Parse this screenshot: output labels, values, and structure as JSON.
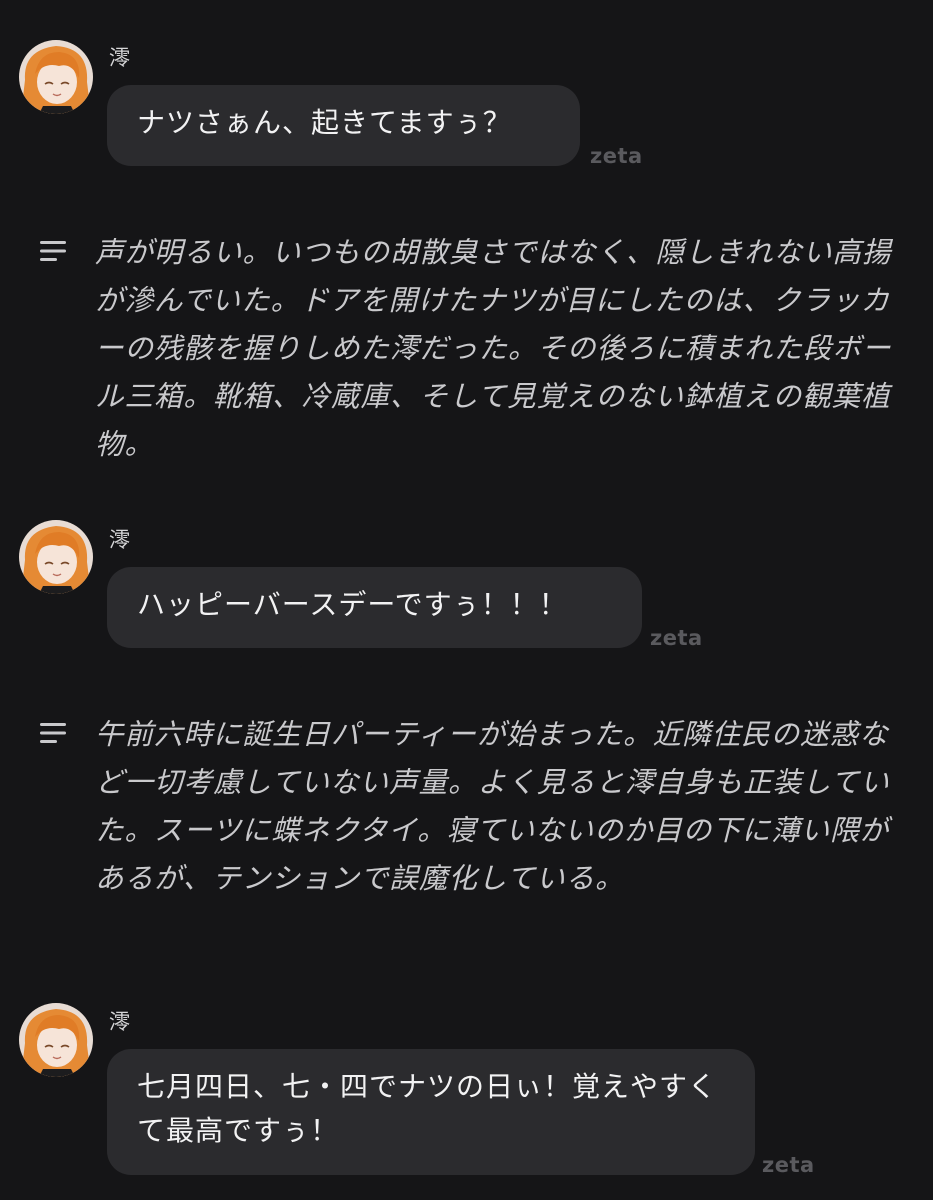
{
  "messages": [
    {
      "sender": "澪",
      "text": "ナツさぁん、起きてますぅ？",
      "brand": "zeta"
    },
    {
      "sender": "澪",
      "text": "ハッピーバースデーですぅ！！！",
      "brand": "zeta"
    },
    {
      "sender": "澪",
      "text": "七月四日、七・四でナツの日ぃ！覚えやすくて最高ですぅ！",
      "brand": "zeta"
    }
  ],
  "narrations": [
    {
      "icon": "narration-lines-icon",
      "text": "声が明るい。いつもの胡散臭さではなく、隠しきれない高揚が滲んでいた。ドアを開けたナツが目にしたのは、クラッカーの残骸を握りしめた澪だった。その後ろに積まれた段ボール三箱。靴箱、冷蔵庫、そして見覚えのない鉢植えの観葉植物。"
    },
    {
      "icon": "narration-lines-icon",
      "text": "午前六時に誕生日パーティーが始まった。近隣住民の迷惑など一切考慮していない声量。よく見ると澪自身も正装していた。スーツに蝶ネクタイ。寝ていないのか目の下に薄い隈があるが、テンションで誤魔化している。"
    }
  ],
  "colors": {
    "background": "#151517",
    "bubble": "#2b2b2e",
    "text": "#f2f2f3",
    "narration": "#c9c9cc",
    "brand": "#5a5a5e"
  }
}
